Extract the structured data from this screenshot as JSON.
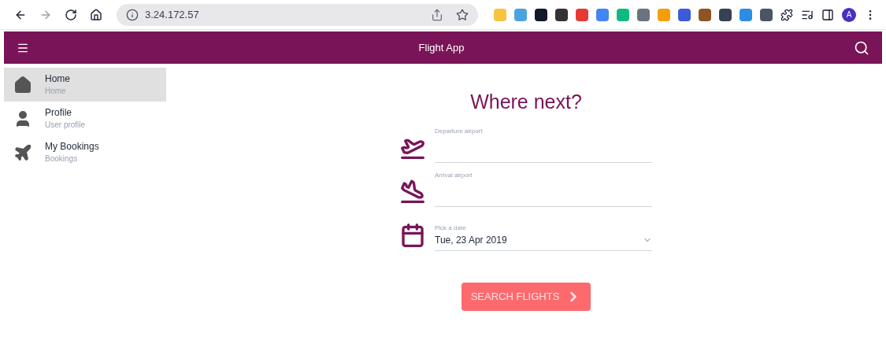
{
  "browser": {
    "nav_buttons": [
      {
        "kind": "back",
        "disabled": false
      },
      {
        "kind": "forward",
        "disabled": true
      },
      {
        "kind": "reload",
        "disabled": false
      },
      {
        "kind": "home",
        "disabled": false
      }
    ],
    "url": "3.24.172.57",
    "avatar": "A"
  },
  "app_bar": {
    "title": "Flight App"
  },
  "sidebar": {
    "items": [
      {
        "kind": "home",
        "title": "Home",
        "subtitle": "Home",
        "selected": true
      },
      {
        "kind": "person",
        "title": "Profile",
        "subtitle": "User profile",
        "selected": false
      },
      {
        "kind": "plane",
        "title": "My Bookings",
        "subtitle": "Bookings",
        "selected": false
      }
    ]
  },
  "main": {
    "heading": "Where next?",
    "fields": [
      {
        "kind": "departure",
        "label": "Departure airport"
      },
      {
        "kind": "arrival",
        "label": "Arrival airport"
      },
      {
        "kind": "date",
        "label": "Pick a date",
        "value": "Tue, 23 Apr 2019"
      }
    ],
    "button": "SEARCH FLIGHTS"
  }
}
